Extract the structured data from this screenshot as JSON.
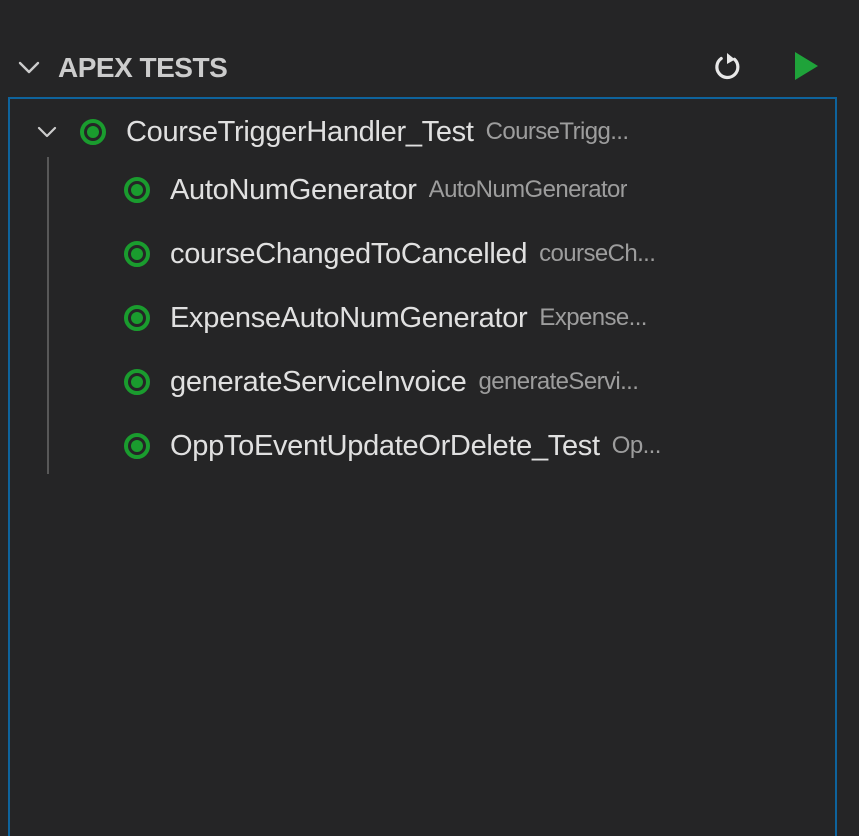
{
  "panel": {
    "title": "APEX TESTS",
    "actions": {
      "refresh_icon": "refresh-icon",
      "run_icon": "run-icon"
    }
  },
  "colors": {
    "background": "#252526",
    "focus_border": "#0e639c",
    "pass": "#1a9c2e",
    "text": "#e0e0e0",
    "description": "#9d9d9d",
    "run_button": "#1fa33a"
  },
  "tree": {
    "class": {
      "name": "CourseTriggerHandler_Test",
      "description": "CourseTrigg...",
      "status": "passed",
      "expanded": true
    },
    "methods": [
      {
        "name": "AutoNumGenerator",
        "description": "AutoNumGenerator",
        "status": "passed"
      },
      {
        "name": "courseChangedToCancelled",
        "description": "courseCh...",
        "status": "passed"
      },
      {
        "name": "ExpenseAutoNumGenerator",
        "description": "Expense...",
        "status": "passed"
      },
      {
        "name": "generateServiceInvoice",
        "description": "generateServi...",
        "status": "passed"
      },
      {
        "name": "OppToEventUpdateOrDelete_Test",
        "description": "Op...",
        "status": "passed"
      }
    ]
  }
}
